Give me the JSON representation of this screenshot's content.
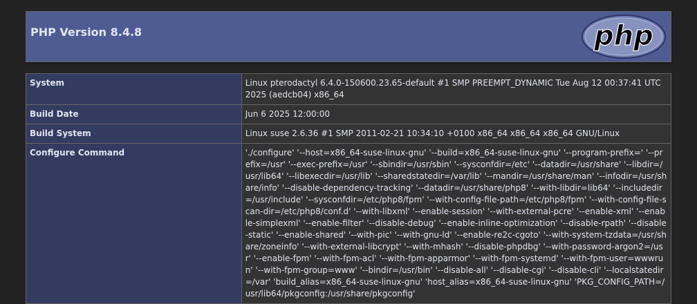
{
  "header": {
    "title": "PHP Version 8.4.8",
    "logo_text": "php"
  },
  "colors": {
    "header_bg": "#4f5b93",
    "key_bg": "#333b60",
    "value_bg": "#333333",
    "page_bg": "#222222",
    "text": "#e2e4ef"
  },
  "rows": [
    {
      "key": "System",
      "value": "Linux pterodactyl 6.4.0-150600.23.65-default #1 SMP PREEMPT_DYNAMIC Tue Aug 12 00:37:41 UTC 2025 (aedcb04) x86_64"
    },
    {
      "key": "Build Date",
      "value": "Jun 6 2025 12:00:00"
    },
    {
      "key": "Build System",
      "value": "Linux suse 2.6.36 #1 SMP 2011-02-21 10:34:10 +0100 x86_64 x86_64 x86_64 GNU/Linux"
    },
    {
      "key": "Configure Command",
      "value": "'./configure' '--host=x86_64-suse-linux-gnu' '--build=x86_64-suse-linux-gnu' '--program-prefix=' '--prefix=/usr' '--exec-prefix=/usr' '--sbindir=/usr/sbin' '--sysconfdir=/etc' '--datadir=/usr/share' '--libdir=/usr/lib64' '--libexecdir=/usr/lib' '--sharedstatedir=/var/lib' '--mandir=/usr/share/man' '--infodir=/usr/share/info' '--disable-dependency-tracking' '--datadir=/usr/share/php8' '--with-libdir=lib64' '--includedir=/usr/include' '--sysconfdir=/etc/php8/fpm' '--with-config-file-path=/etc/php8/fpm' '--with-config-file-scan-dir=/etc/php8/conf.d' '--with-libxml' '--enable-session' '--with-external-pcre' '--enable-xml' '--enable-simplexml' '--enable-filter' '--disable-debug' '--enable-inline-optimization' '--disable-rpath' '--disable-static' '--enable-shared' '--with-pic' '--with-gnu-ld' '--enable-re2c-cgoto' '--with-system-tzdata=/usr/share/zoneinfo' '--with-external-libcrypt' '--with-mhash' '--disable-phpdbg' '--with-password-argon2=/usr' '--enable-fpm' '--with-fpm-acl' '--with-fpm-apparmor' '--with-fpm-systemd' '--with-fpm-user=wwwrun' '--with-fpm-group=www' '--bindir=/usr/bin' '--disable-all' '--disable-cgi' '--disable-cli' '--localstatedir=/var' 'build_alias=x86_64-suse-linux-gnu' 'host_alias=x86_64-suse-linux-gnu' 'PKG_CONFIG_PATH=/usr/lib64/pkgconfig:/usr/share/pkgconfig'"
    }
  ]
}
